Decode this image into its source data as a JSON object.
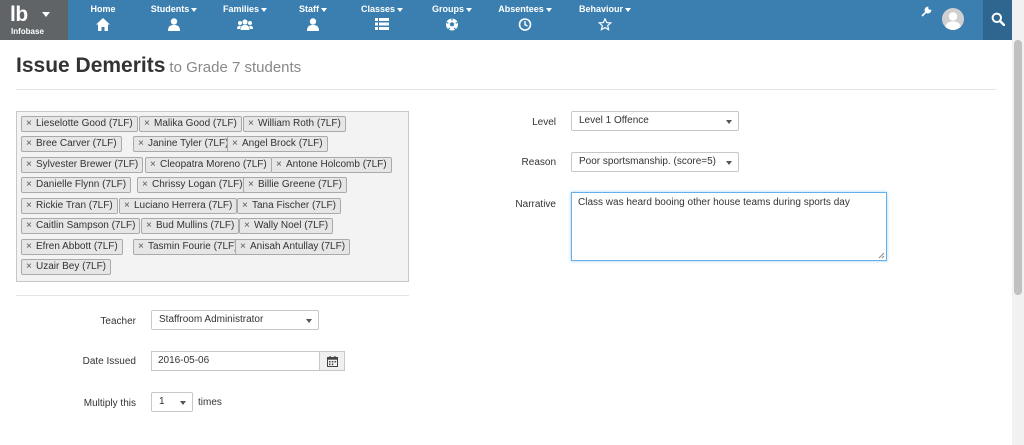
{
  "app": {
    "logo": "lb",
    "logo_sub": "Infobase"
  },
  "nav": [
    {
      "label": "Home",
      "dropdown": false,
      "icon": "home-icon"
    },
    {
      "label": "Students",
      "dropdown": true,
      "icon": "user-icon"
    },
    {
      "label": "Families",
      "dropdown": true,
      "icon": "users-icon"
    },
    {
      "label": "Staff",
      "dropdown": true,
      "icon": "user-icon"
    },
    {
      "label": "Classes",
      "dropdown": true,
      "icon": "list-icon"
    },
    {
      "label": "Groups",
      "dropdown": true,
      "icon": "soccer-ball-icon"
    },
    {
      "label": "Absentees",
      "dropdown": true,
      "icon": "clock-icon"
    },
    {
      "label": "Behaviour",
      "dropdown": true,
      "icon": "star-icon"
    }
  ],
  "header": {
    "title": "Issue Demerits",
    "subtitle": "to Grade 7 students"
  },
  "students": [
    "Lieselotte Good (7LF)",
    "Malika Good (7LF)",
    "William Roth (7LF)",
    "Bree Carver (7LF)",
    "Janine Tyler (7LF)",
    "Angel Brock (7LF)",
    "Sylvester Brewer (7LF)",
    "Cleopatra Moreno (7LF)",
    "Antone Holcomb (7LF)",
    "Danielle Flynn (7LF)",
    "Chrissy Logan (7LF)",
    "Billie Greene (7LF)",
    "Rickie Tran (7LF)",
    "Luciano Herrera (7LF)",
    "Tana Fischer (7LF)",
    "Caitlin Sampson (7LF)",
    "Bud Mullins (7LF)",
    "Wally Noel (7LF)",
    "Efren Abbott (7LF)",
    "Tasmin Fourie (7LF)",
    "Anisah Antullay (7LF)",
    "Uzair Bey (7LF)"
  ],
  "form": {
    "level_label": "Level",
    "level_value": "Level 1 Offence",
    "reason_label": "Reason",
    "reason_value": "Poor sportsmanship. (score=5)",
    "narrative_label": "Narrative",
    "narrative_value": "Class was heard booing other house teams during sports day",
    "teacher_label": "Teacher",
    "teacher_value": "Staffroom Administrator",
    "date_label": "Date Issued",
    "date_value": "2016-05-06",
    "multiply_label": "Multiply this",
    "multiply_value": "1",
    "multiply_suffix": "times"
  },
  "colors": {
    "nav_bg": "#3a7fb0",
    "logo_bg": "#606466",
    "search_bg": "#2f6690",
    "focus": "#66afe9"
  }
}
